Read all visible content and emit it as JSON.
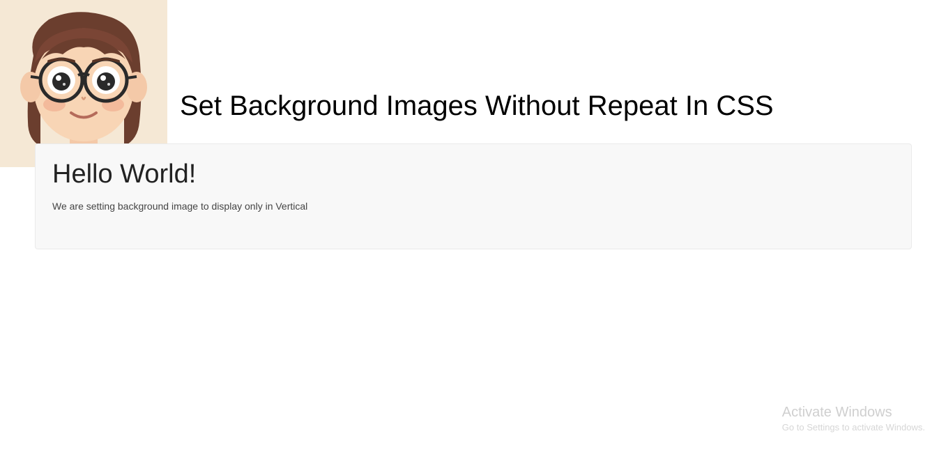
{
  "page": {
    "title": "Set Background Images Without Repeat In CSS"
  },
  "content": {
    "heading": "Hello World!",
    "paragraph": "We are setting background image to display only in Vertical"
  },
  "watermark": {
    "title": "Activate Windows",
    "subtitle": "Go to Settings to activate Windows."
  }
}
